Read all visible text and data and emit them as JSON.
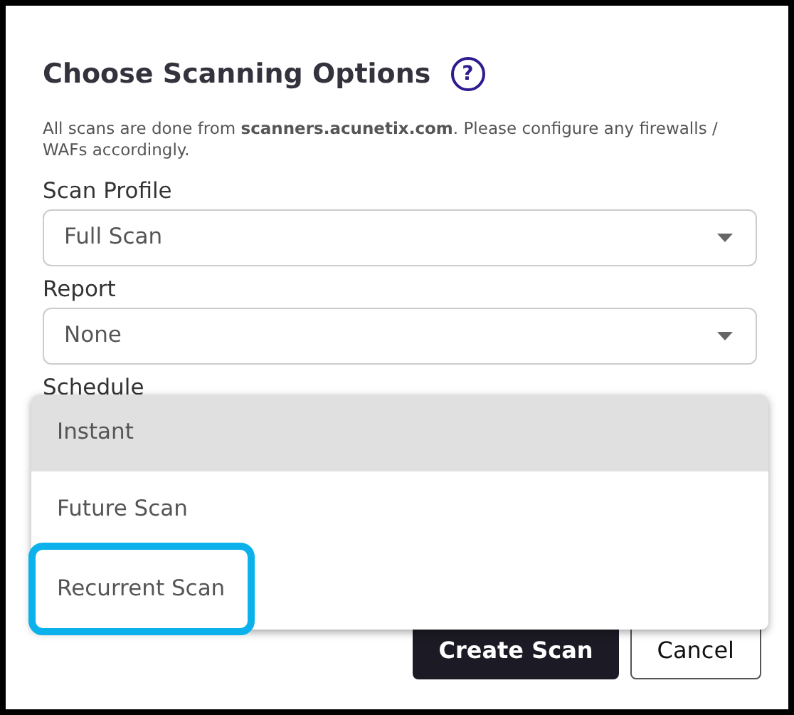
{
  "dialog": {
    "title": "Choose Scanning Options",
    "help_icon": "?",
    "note": "All scans are done from **scanners.acunetix.com**. Please configure any firewalls / WAFs accordingly."
  },
  "fields": [
    {
      "label": "Scan Profile",
      "value": "Full Scan"
    },
    {
      "label": "Report",
      "value": "None"
    },
    {
      "label": "Schedule"
    }
  ],
  "dropdown_options": [
    {
      "label": "Instant",
      "selected": true,
      "highlighted": false
    },
    {
      "label": "Future Scan",
      "selected": false,
      "highlighted": false
    },
    {
      "label": "Recurrent Scan",
      "selected": false,
      "highlighted": true
    }
  ],
  "buttons": [
    {
      "label": "Create Scan",
      "kind": "primary"
    },
    {
      "label": "Cancel",
      "kind": "secondary"
    }
  ]
}
